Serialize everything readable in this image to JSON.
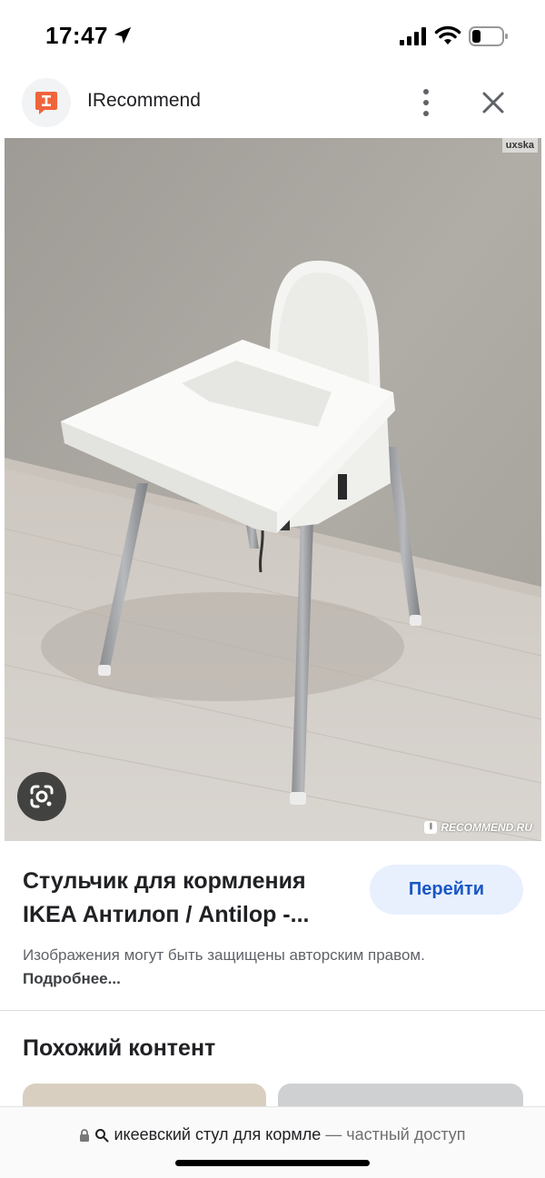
{
  "status_bar": {
    "time": "17:47",
    "icons": [
      "location-arrow-icon",
      "signal-icon",
      "wifi-icon",
      "battery-icon"
    ]
  },
  "header": {
    "site_name": "IRecommend",
    "logo_letter": "I",
    "logo_color": "#f0643c",
    "icons": [
      "more-vert-icon",
      "close-icon"
    ]
  },
  "image": {
    "watermark_user": "uxska",
    "watermark_site": "RECOMMEND.RU",
    "watermark_badge": "I",
    "lens_icon": "google-lens-icon"
  },
  "result": {
    "title_line1": "Стульчик для кормления",
    "title_line2": "IKEA Антилоп / Antilop -...",
    "go_button": "Перейти",
    "copyright_text": "Изображения могут быть защищены авторским правом.",
    "more_link": "Подробнее..."
  },
  "similar": {
    "heading": "Похожий контент"
  },
  "address_bar": {
    "query": "икеевский стул для кормле",
    "private_label": "— частный доступ"
  },
  "colors": {
    "accent_blue": "#1a57c5",
    "button_bg": "#e8f0fe",
    "logo_orange": "#f0643c"
  }
}
